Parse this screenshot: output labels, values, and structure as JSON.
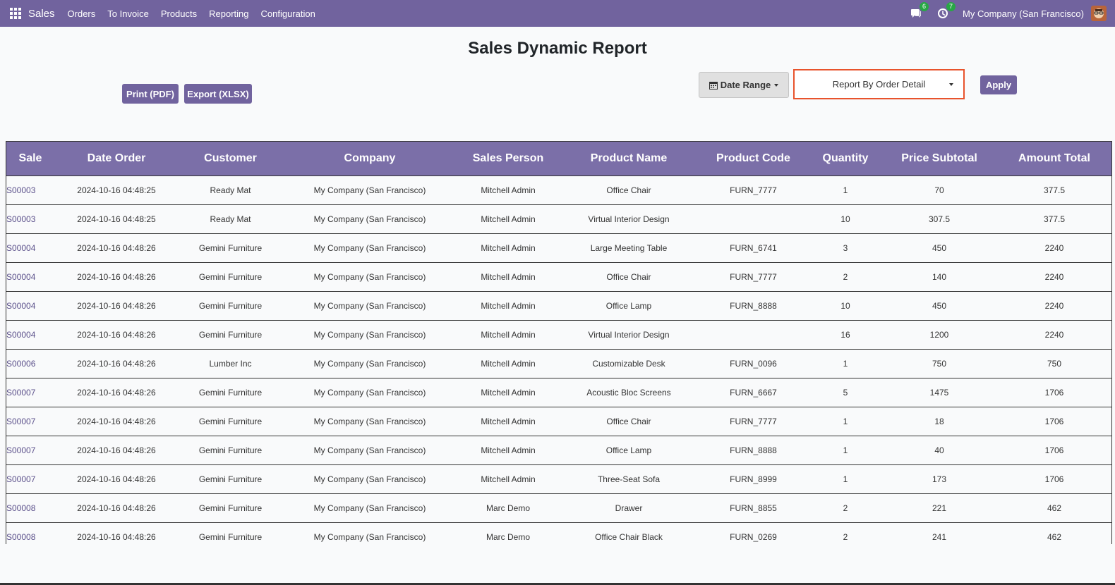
{
  "nav": {
    "brand": "Sales",
    "menu": [
      "Orders",
      "To Invoice",
      "Products",
      "Reporting",
      "Configuration"
    ],
    "messages_badge": "6",
    "activity_badge": "7",
    "company": "My Company (San Francisco)"
  },
  "report": {
    "title": "Sales Dynamic Report",
    "print_label": "Print (PDF)",
    "export_label": "Export (XLSX)",
    "date_range_label": "Date Range",
    "report_type": "Report By Order Detail",
    "apply_label": "Apply"
  },
  "table": {
    "columns": [
      "Sale",
      "Date Order",
      "Customer",
      "Company",
      "Sales Person",
      "Product Name",
      "Product Code",
      "Quantity",
      "Price Subtotal",
      "Amount Total"
    ],
    "rows": [
      [
        "S00003",
        "2024-10-16 04:48:25",
        "Ready Mat",
        "My Company (San Francisco)",
        "Mitchell Admin",
        "Office Chair",
        "FURN_7777",
        "1",
        "70",
        "377.5"
      ],
      [
        "S00003",
        "2024-10-16 04:48:25",
        "Ready Mat",
        "My Company (San Francisco)",
        "Mitchell Admin",
        "Virtual Interior Design",
        "",
        "10",
        "307.5",
        "377.5"
      ],
      [
        "S00004",
        "2024-10-16 04:48:26",
        "Gemini Furniture",
        "My Company (San Francisco)",
        "Mitchell Admin",
        "Large Meeting Table",
        "FURN_6741",
        "3",
        "450",
        "2240"
      ],
      [
        "S00004",
        "2024-10-16 04:48:26",
        "Gemini Furniture",
        "My Company (San Francisco)",
        "Mitchell Admin",
        "Office Chair",
        "FURN_7777",
        "2",
        "140",
        "2240"
      ],
      [
        "S00004",
        "2024-10-16 04:48:26",
        "Gemini Furniture",
        "My Company (San Francisco)",
        "Mitchell Admin",
        "Office Lamp",
        "FURN_8888",
        "10",
        "450",
        "2240"
      ],
      [
        "S00004",
        "2024-10-16 04:48:26",
        "Gemini Furniture",
        "My Company (San Francisco)",
        "Mitchell Admin",
        "Virtual Interior Design",
        "",
        "16",
        "1200",
        "2240"
      ],
      [
        "S00006",
        "2024-10-16 04:48:26",
        "Lumber Inc",
        "My Company (San Francisco)",
        "Mitchell Admin",
        "Customizable Desk",
        "FURN_0096",
        "1",
        "750",
        "750"
      ],
      [
        "S00007",
        "2024-10-16 04:48:26",
        "Gemini Furniture",
        "My Company (San Francisco)",
        "Mitchell Admin",
        "Acoustic Bloc Screens",
        "FURN_6667",
        "5",
        "1475",
        "1706"
      ],
      [
        "S00007",
        "2024-10-16 04:48:26",
        "Gemini Furniture",
        "My Company (San Francisco)",
        "Mitchell Admin",
        "Office Chair",
        "FURN_7777",
        "1",
        "18",
        "1706"
      ],
      [
        "S00007",
        "2024-10-16 04:48:26",
        "Gemini Furniture",
        "My Company (San Francisco)",
        "Mitchell Admin",
        "Office Lamp",
        "FURN_8888",
        "1",
        "40",
        "1706"
      ],
      [
        "S00007",
        "2024-10-16 04:48:26",
        "Gemini Furniture",
        "My Company (San Francisco)",
        "Mitchell Admin",
        "Three-Seat Sofa",
        "FURN_8999",
        "1",
        "173",
        "1706"
      ],
      [
        "S00008",
        "2024-10-16 04:48:26",
        "Gemini Furniture",
        "My Company (San Francisco)",
        "Marc Demo",
        "Drawer",
        "FURN_8855",
        "2",
        "221",
        "462"
      ],
      [
        "S00008",
        "2024-10-16 04:48:26",
        "Gemini Furniture",
        "My Company (San Francisco)",
        "Marc Demo",
        "Office Chair Black",
        "FURN_0269",
        "2",
        "241",
        "462"
      ]
    ]
  },
  "colors": {
    "accent": "#71639e",
    "header_bg": "#7b6fa8",
    "highlight_border": "#e8532c",
    "badge": "#28a745"
  },
  "icons": [
    "apps-grid-icon",
    "chat-icon",
    "clock-icon",
    "avatar",
    "calendar-icon",
    "caret-down-icon"
  ]
}
